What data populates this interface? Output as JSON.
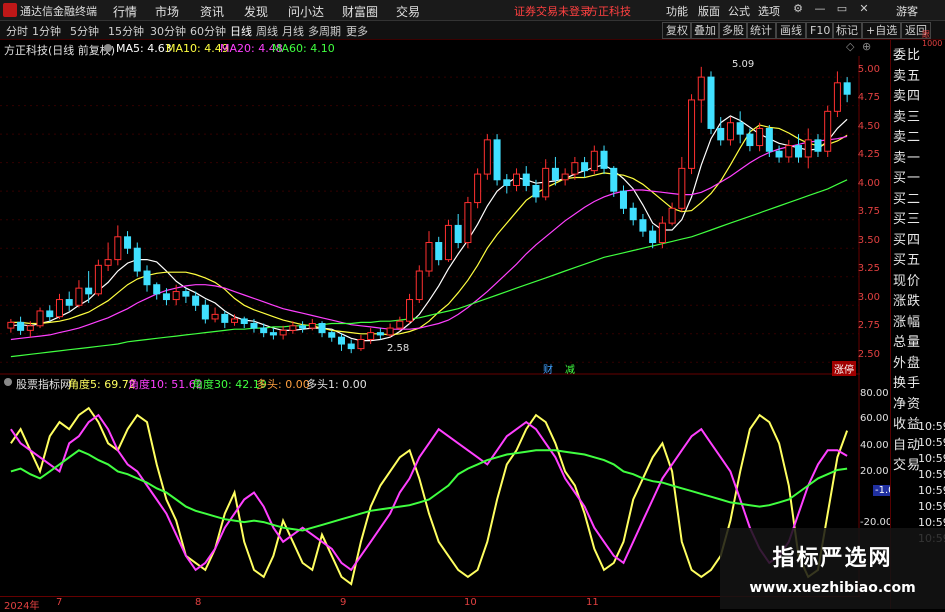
{
  "titlebar": {
    "app_name": "通达信金融终端",
    "menus": [
      "行情",
      "市场",
      "资讯",
      "发现",
      "问小达",
      "财富圈",
      "交易"
    ],
    "notice": "证券交易未登录",
    "stock_name": "方正科技",
    "right_menus": [
      "功能",
      "版面",
      "公式",
      "选项"
    ],
    "guest": "游客"
  },
  "toolbar": {
    "periods": [
      "分时",
      "1分钟",
      "5分钟",
      "15分钟",
      "30分钟",
      "60分钟",
      "日线",
      "周线",
      "月线",
      "多周期",
      "更多"
    ],
    "active_period": "日线",
    "right_buttons": [
      "复权",
      "叠加",
      "多股",
      "统计",
      "画线",
      "F10",
      "标记",
      "+自选",
      "返回"
    ]
  },
  "infobar": {
    "title": "方正科技(日线 前复权)",
    "ma5": "MA5: 4.63",
    "ma10": "MA10: 4.49",
    "ma20": "MA20: 4.48",
    "ma60": "MA60: 4.10",
    "colors": {
      "ma5": "#ffffff",
      "ma10": "#ffff40",
      "ma20": "#ff40ff",
      "ma60": "#40ff40"
    }
  },
  "price_axis": [
    "5.00",
    "4.75",
    "4.50",
    "4.25",
    "4.00",
    "3.75",
    "3.50",
    "3.25",
    "3.00",
    "2.75",
    "2.50"
  ],
  "price_annotations": {
    "high": "5.09",
    "low": "2.58"
  },
  "price_tags": {
    "cai": "财",
    "cang": "减",
    "tag": "涨停"
  },
  "right_panel": [
    "委比",
    "卖五",
    "卖四",
    "卖三",
    "卖二",
    "卖一",
    "买一",
    "买二",
    "买三",
    "买四",
    "买五",
    "现价",
    "涨跌",
    "涨幅",
    "总量",
    "外盘",
    "换手",
    "净资",
    "收益",
    "自动",
    "交易"
  ],
  "right_panel_top": "跟\n1000",
  "indicator": {
    "name": "股票指标网",
    "a5": "角度5: 69.72",
    "a10": "角度10: 51.62",
    "a30": "角度30: 42.19",
    "duotou": "多头: 0.00",
    "duotou1": "多头1: 0.00",
    "colors": {
      "a5": "#ffff60",
      "a10": "#ff40ff",
      "a30": "#40ff40"
    }
  },
  "indicator_axis": [
    "80.00",
    "60.00",
    "40.00",
    "20.00",
    "-1.02",
    "-20.00"
  ],
  "time_labels": [
    "10:59",
    "10:59",
    "10:59",
    "10:59",
    "10:59",
    "10:59",
    "10:59",
    "10:59"
  ],
  "dates": [
    "2024年",
    "7",
    "8",
    "9",
    "10",
    "11"
  ],
  "watermark": {
    "title": "指标严选网",
    "url": "www.xuezhibiao.com"
  },
  "chart_data": {
    "type": "candlestick",
    "ylim": [
      2.45,
      5.15
    ],
    "candles": [
      [
        2.8,
        2.85,
        2.76,
        2.88
      ],
      [
        2.85,
        2.78,
        2.74,
        2.9
      ],
      [
        2.78,
        2.82,
        2.72,
        2.86
      ],
      [
        2.82,
        2.95,
        2.8,
        2.98
      ],
      [
        2.95,
        2.9,
        2.86,
        3.0
      ],
      [
        2.9,
        3.05,
        2.88,
        3.1
      ],
      [
        3.05,
        3.0,
        2.95,
        3.12
      ],
      [
        3.0,
        3.15,
        2.98,
        3.22
      ],
      [
        3.15,
        3.1,
        3.02,
        3.3
      ],
      [
        3.1,
        3.35,
        3.08,
        3.4
      ],
      [
        3.35,
        3.4,
        3.3,
        3.55
      ],
      [
        3.4,
        3.6,
        3.35,
        3.7
      ],
      [
        3.6,
        3.5,
        3.45,
        3.65
      ],
      [
        3.5,
        3.3,
        3.25,
        3.55
      ],
      [
        3.3,
        3.18,
        3.12,
        3.35
      ],
      [
        3.18,
        3.1,
        3.05,
        3.2
      ],
      [
        3.1,
        3.05,
        3.0,
        3.15
      ],
      [
        3.05,
        3.12,
        3.0,
        3.18
      ],
      [
        3.12,
        3.08,
        3.02,
        3.15
      ],
      [
        3.08,
        3.0,
        2.95,
        3.12
      ],
      [
        3.0,
        2.88,
        2.84,
        3.05
      ],
      [
        2.88,
        2.92,
        2.85,
        2.98
      ],
      [
        2.92,
        2.85,
        2.8,
        2.95
      ],
      [
        2.85,
        2.88,
        2.82,
        2.92
      ],
      [
        2.88,
        2.84,
        2.8,
        2.9
      ],
      [
        2.84,
        2.8,
        2.76,
        2.88
      ],
      [
        2.8,
        2.76,
        2.72,
        2.84
      ],
      [
        2.76,
        2.74,
        2.7,
        2.8
      ],
      [
        2.74,
        2.78,
        2.7,
        2.82
      ],
      [
        2.78,
        2.82,
        2.75,
        2.86
      ],
      [
        2.82,
        2.8,
        2.76,
        2.86
      ],
      [
        2.8,
        2.84,
        2.78,
        2.88
      ],
      [
        2.84,
        2.76,
        2.72,
        2.86
      ],
      [
        2.76,
        2.72,
        2.68,
        2.78
      ],
      [
        2.72,
        2.66,
        2.6,
        2.75
      ],
      [
        2.66,
        2.62,
        2.58,
        2.7
      ],
      [
        2.62,
        2.7,
        2.6,
        2.74
      ],
      [
        2.7,
        2.76,
        2.66,
        2.8
      ],
      [
        2.76,
        2.74,
        2.7,
        2.8
      ],
      [
        2.74,
        2.8,
        2.72,
        2.84
      ],
      [
        2.8,
        2.86,
        2.78,
        2.9
      ],
      [
        2.86,
        3.05,
        2.84,
        3.1
      ],
      [
        3.05,
        3.3,
        3.02,
        3.35
      ],
      [
        3.3,
        3.55,
        3.25,
        3.65
      ],
      [
        3.55,
        3.4,
        3.35,
        3.6
      ],
      [
        3.4,
        3.7,
        3.38,
        3.75
      ],
      [
        3.7,
        3.55,
        3.5,
        3.8
      ],
      [
        3.55,
        3.9,
        3.5,
        3.95
      ],
      [
        3.9,
        4.15,
        3.85,
        4.2
      ],
      [
        4.15,
        4.45,
        4.1,
        4.5
      ],
      [
        4.45,
        4.1,
        4.05,
        4.5
      ],
      [
        4.1,
        4.05,
        3.98,
        4.15
      ],
      [
        4.05,
        4.15,
        4.0,
        4.2
      ],
      [
        4.15,
        4.05,
        4.0,
        4.22
      ],
      [
        4.05,
        3.95,
        3.9,
        4.1
      ],
      [
        3.95,
        4.2,
        3.92,
        4.28
      ],
      [
        4.2,
        4.1,
        4.05,
        4.3
      ],
      [
        4.1,
        4.15,
        4.05,
        4.2
      ],
      [
        4.15,
        4.25,
        4.1,
        4.3
      ],
      [
        4.25,
        4.18,
        4.12,
        4.3
      ],
      [
        4.18,
        4.35,
        4.15,
        4.4
      ],
      [
        4.35,
        4.2,
        4.15,
        4.4
      ],
      [
        4.2,
        4.0,
        3.95,
        4.22
      ],
      [
        4.0,
        3.85,
        3.8,
        4.05
      ],
      [
        3.85,
        3.75,
        3.7,
        3.9
      ],
      [
        3.75,
        3.65,
        3.6,
        3.8
      ],
      [
        3.65,
        3.55,
        3.5,
        3.7
      ],
      [
        3.55,
        3.72,
        3.5,
        3.78
      ],
      [
        3.72,
        3.85,
        3.7,
        3.9
      ],
      [
        3.85,
        4.2,
        3.82,
        4.3
      ],
      [
        4.2,
        4.8,
        4.15,
        4.85
      ],
      [
        4.8,
        5.0,
        4.6,
        5.09
      ],
      [
        5.0,
        4.55,
        4.5,
        5.05
      ],
      [
        4.55,
        4.45,
        4.4,
        4.65
      ],
      [
        4.45,
        4.6,
        4.4,
        4.65
      ],
      [
        4.6,
        4.5,
        4.42,
        4.7
      ],
      [
        4.5,
        4.4,
        4.35,
        4.55
      ],
      [
        4.4,
        4.55,
        4.35,
        4.6
      ],
      [
        4.55,
        4.35,
        4.3,
        4.58
      ],
      [
        4.35,
        4.3,
        4.25,
        4.4
      ],
      [
        4.3,
        4.4,
        4.25,
        4.45
      ],
      [
        4.4,
        4.3,
        4.25,
        4.5
      ],
      [
        4.3,
        4.45,
        4.2,
        4.55
      ],
      [
        4.45,
        4.35,
        4.3,
        4.5
      ],
      [
        4.35,
        4.7,
        4.3,
        4.75
      ],
      [
        4.7,
        4.95,
        4.65,
        5.05
      ],
      [
        4.95,
        4.85,
        4.78,
        5.0
      ]
    ],
    "ma_series": [
      {
        "name": "MA5",
        "values": [
          2.82,
          2.83,
          2.82,
          2.84,
          2.86,
          2.9,
          2.94,
          3.0,
          3.05,
          3.13,
          3.2,
          3.3,
          3.37,
          3.4,
          3.4,
          3.38,
          3.3,
          3.21,
          3.15,
          3.11,
          3.06,
          3.02,
          2.95,
          2.9,
          2.87,
          2.86,
          2.83,
          2.8,
          2.78,
          2.78,
          2.79,
          2.8,
          2.8,
          2.79,
          2.75,
          2.71,
          2.69,
          2.69,
          2.7,
          2.72,
          2.77,
          2.84,
          2.92,
          3.04,
          3.17,
          3.32,
          3.45,
          3.57,
          3.71,
          3.87,
          4.0,
          4.07,
          4.12,
          4.1,
          4.07,
          4.08,
          4.09,
          4.11,
          4.15,
          4.18,
          4.21,
          4.23,
          4.18,
          4.11,
          4.02,
          3.88,
          3.72,
          3.66,
          3.66,
          3.75,
          3.95,
          4.23,
          4.46,
          4.6,
          4.66,
          4.62,
          4.56,
          4.5,
          4.46,
          4.42,
          4.4,
          4.38,
          4.36,
          4.37,
          4.44,
          4.55,
          4.63
        ]
      },
      {
        "name": "MA10",
        "values": [
          2.85,
          2.85,
          2.84,
          2.84,
          2.85,
          2.86,
          2.88,
          2.91,
          2.94,
          2.99,
          3.04,
          3.11,
          3.18,
          3.23,
          3.26,
          3.28,
          3.29,
          3.29,
          3.29,
          3.27,
          3.24,
          3.2,
          3.14,
          3.06,
          3.0,
          2.96,
          2.93,
          2.9,
          2.87,
          2.85,
          2.83,
          2.82,
          2.8,
          2.78,
          2.77,
          2.76,
          2.75,
          2.75,
          2.75,
          2.74,
          2.75,
          2.77,
          2.8,
          2.86,
          2.94,
          3.01,
          3.11,
          3.22,
          3.35,
          3.5,
          3.62,
          3.72,
          3.82,
          3.92,
          3.98,
          4.03,
          4.07,
          4.11,
          4.12,
          4.12,
          4.14,
          4.16,
          4.15,
          4.14,
          4.11,
          4.06,
          3.99,
          3.92,
          3.85,
          3.82,
          3.83,
          3.9,
          3.98,
          4.09,
          4.23,
          4.38,
          4.52,
          4.58,
          4.56,
          4.55,
          4.51,
          4.46,
          4.42,
          4.4,
          4.41,
          4.44,
          4.49
        ]
      },
      {
        "name": "MA20",
        "values": [
          2.7,
          2.71,
          2.72,
          2.73,
          2.74,
          2.76,
          2.78,
          2.8,
          2.83,
          2.86,
          2.89,
          2.93,
          2.97,
          3.02,
          3.06,
          3.1,
          3.13,
          3.15,
          3.17,
          3.18,
          3.18,
          3.17,
          3.15,
          3.12,
          3.09,
          3.06,
          3.03,
          3.0,
          2.97,
          2.95,
          2.93,
          2.91,
          2.89,
          2.87,
          2.85,
          2.83,
          2.82,
          2.81,
          2.8,
          2.79,
          2.79,
          2.79,
          2.8,
          2.82,
          2.84,
          2.87,
          2.92,
          2.98,
          3.05,
          3.12,
          3.2,
          3.28,
          3.36,
          3.45,
          3.53,
          3.6,
          3.67,
          3.74,
          3.8,
          3.86,
          3.91,
          3.95,
          3.98,
          4.0,
          4.01,
          4.01,
          4.0,
          3.99,
          3.98,
          3.97,
          3.97,
          3.99,
          4.03,
          4.08,
          4.13,
          4.19,
          4.25,
          4.3,
          4.34,
          4.37,
          4.39,
          4.41,
          4.43,
          4.44,
          4.45,
          4.46,
          4.48
        ]
      },
      {
        "name": "MA60",
        "values": [
          2.55,
          2.56,
          2.57,
          2.58,
          2.59,
          2.6,
          2.61,
          2.62,
          2.63,
          2.64,
          2.65,
          2.66,
          2.68,
          2.69,
          2.7,
          2.71,
          2.72,
          2.73,
          2.74,
          2.75,
          2.76,
          2.77,
          2.78,
          2.79,
          2.79,
          2.8,
          2.8,
          2.81,
          2.81,
          2.82,
          2.82,
          2.83,
          2.83,
          2.84,
          2.84,
          2.84,
          2.85,
          2.85,
          2.86,
          2.86,
          2.87,
          2.88,
          2.89,
          2.91,
          2.93,
          2.95,
          2.97,
          3.0,
          3.03,
          3.06,
          3.09,
          3.12,
          3.15,
          3.18,
          3.21,
          3.24,
          3.27,
          3.3,
          3.33,
          3.36,
          3.39,
          3.42,
          3.44,
          3.46,
          3.48,
          3.5,
          3.52,
          3.54,
          3.56,
          3.58,
          3.6,
          3.63,
          3.66,
          3.69,
          3.72,
          3.75,
          3.78,
          3.81,
          3.84,
          3.87,
          3.9,
          3.93,
          3.96,
          3.99,
          4.02,
          4.06,
          4.1
        ]
      }
    ],
    "indicator_series": [
      {
        "name": "角度5",
        "values": [
          60,
          70,
          55,
          40,
          65,
          75,
          70,
          80,
          85,
          75,
          60,
          55,
          70,
          80,
          75,
          45,
          20,
          5,
          -20,
          -25,
          -30,
          -15,
          10,
          25,
          -10,
          -30,
          -35,
          -20,
          5,
          -10,
          -25,
          -30,
          -5,
          -20,
          -35,
          -40,
          -10,
          15,
          30,
          40,
          50,
          55,
          35,
          10,
          -10,
          -20,
          -30,
          -35,
          -30,
          -10,
          20,
          45,
          55,
          70,
          80,
          75,
          60,
          40,
          30,
          10,
          -15,
          -30,
          -25,
          -10,
          20,
          35,
          50,
          60,
          40,
          -10,
          -30,
          -35,
          -30,
          -20,
          5,
          40,
          70,
          80,
          75,
          60,
          30,
          -20,
          -35,
          -30,
          10,
          50,
          69
        ]
      },
      {
        "name": "角度10",
        "values": [
          70,
          60,
          55,
          50,
          45,
          40,
          60,
          65,
          75,
          80,
          70,
          55,
          45,
          40,
          30,
          20,
          10,
          -5,
          -20,
          -30,
          -25,
          -15,
          0,
          10,
          20,
          25,
          15,
          0,
          -10,
          -5,
          0,
          -5,
          -10,
          -15,
          -25,
          -30,
          -20,
          -10,
          0,
          10,
          25,
          35,
          50,
          60,
          70,
          65,
          60,
          55,
          50,
          45,
          55,
          65,
          70,
          75,
          70,
          60,
          50,
          35,
          25,
          15,
          0,
          -10,
          -20,
          -25,
          -10,
          5,
          20,
          35,
          45,
          55,
          65,
          70,
          60,
          50,
          40,
          20,
          0,
          -15,
          -25,
          -20,
          -10,
          10,
          30,
          45,
          55,
          55,
          51
        ]
      },
      {
        "name": "角度30",
        "values": [
          40,
          42,
          38,
          35,
          40,
          45,
          50,
          55,
          52,
          48,
          45,
          40,
          38,
          35,
          32,
          28,
          25,
          20,
          15,
          12,
          10,
          8,
          6,
          5,
          4,
          5,
          4,
          2,
          0,
          -1,
          -2,
          0,
          2,
          4,
          6,
          8,
          10,
          12,
          13,
          14,
          15,
          16,
          18,
          20,
          25,
          30,
          38,
          42,
          45,
          48,
          50,
          52,
          53,
          54,
          55,
          55,
          55,
          54,
          53,
          52,
          50,
          48,
          45,
          40,
          38,
          35,
          33,
          32,
          30,
          28,
          26,
          24,
          22,
          20,
          18,
          17,
          16,
          15,
          16,
          18,
          20,
          25,
          30,
          35,
          38,
          41,
          42
        ]
      }
    ]
  }
}
